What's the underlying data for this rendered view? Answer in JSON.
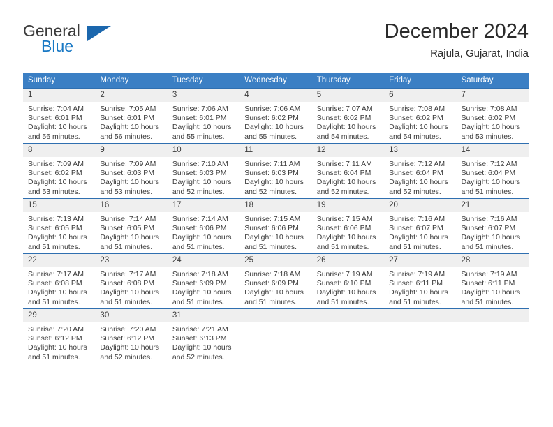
{
  "brand": {
    "name_top": "General",
    "name_bottom": "Blue",
    "triangle_icon": "triangle-logo-icon",
    "color_blue": "#1878c4",
    "color_triangle": "#1b67ad"
  },
  "header": {
    "title": "December 2024",
    "subtitle": "Rajula, Gujarat, India"
  },
  "theme": {
    "header_row_bg": "#3b7fc4",
    "row_border": "#2f6fb0",
    "daynum_bg": "#efefef",
    "text": "#3c3c3c"
  },
  "weekday_headers": [
    "Sunday",
    "Monday",
    "Tuesday",
    "Wednesday",
    "Thursday",
    "Friday",
    "Saturday"
  ],
  "labels": {
    "sunrise_prefix": "Sunrise:",
    "sunset_prefix": "Sunset:",
    "daylight_prefix": "Daylight:"
  },
  "weeks": [
    [
      {
        "day": "1",
        "sunrise": "Sunrise: 7:04 AM",
        "sunset": "Sunset: 6:01 PM",
        "daylight_1": "Daylight: 10 hours",
        "daylight_2": "and 56 minutes."
      },
      {
        "day": "2",
        "sunrise": "Sunrise: 7:05 AM",
        "sunset": "Sunset: 6:01 PM",
        "daylight_1": "Daylight: 10 hours",
        "daylight_2": "and 56 minutes."
      },
      {
        "day": "3",
        "sunrise": "Sunrise: 7:06 AM",
        "sunset": "Sunset: 6:01 PM",
        "daylight_1": "Daylight: 10 hours",
        "daylight_2": "and 55 minutes."
      },
      {
        "day": "4",
        "sunrise": "Sunrise: 7:06 AM",
        "sunset": "Sunset: 6:02 PM",
        "daylight_1": "Daylight: 10 hours",
        "daylight_2": "and 55 minutes."
      },
      {
        "day": "5",
        "sunrise": "Sunrise: 7:07 AM",
        "sunset": "Sunset: 6:02 PM",
        "daylight_1": "Daylight: 10 hours",
        "daylight_2": "and 54 minutes."
      },
      {
        "day": "6",
        "sunrise": "Sunrise: 7:08 AM",
        "sunset": "Sunset: 6:02 PM",
        "daylight_1": "Daylight: 10 hours",
        "daylight_2": "and 54 minutes."
      },
      {
        "day": "7",
        "sunrise": "Sunrise: 7:08 AM",
        "sunset": "Sunset: 6:02 PM",
        "daylight_1": "Daylight: 10 hours",
        "daylight_2": "and 53 minutes."
      }
    ],
    [
      {
        "day": "8",
        "sunrise": "Sunrise: 7:09 AM",
        "sunset": "Sunset: 6:02 PM",
        "daylight_1": "Daylight: 10 hours",
        "daylight_2": "and 53 minutes."
      },
      {
        "day": "9",
        "sunrise": "Sunrise: 7:09 AM",
        "sunset": "Sunset: 6:03 PM",
        "daylight_1": "Daylight: 10 hours",
        "daylight_2": "and 53 minutes."
      },
      {
        "day": "10",
        "sunrise": "Sunrise: 7:10 AM",
        "sunset": "Sunset: 6:03 PM",
        "daylight_1": "Daylight: 10 hours",
        "daylight_2": "and 52 minutes."
      },
      {
        "day": "11",
        "sunrise": "Sunrise: 7:11 AM",
        "sunset": "Sunset: 6:03 PM",
        "daylight_1": "Daylight: 10 hours",
        "daylight_2": "and 52 minutes."
      },
      {
        "day": "12",
        "sunrise": "Sunrise: 7:11 AM",
        "sunset": "Sunset: 6:04 PM",
        "daylight_1": "Daylight: 10 hours",
        "daylight_2": "and 52 minutes."
      },
      {
        "day": "13",
        "sunrise": "Sunrise: 7:12 AM",
        "sunset": "Sunset: 6:04 PM",
        "daylight_1": "Daylight: 10 hours",
        "daylight_2": "and 52 minutes."
      },
      {
        "day": "14",
        "sunrise": "Sunrise: 7:12 AM",
        "sunset": "Sunset: 6:04 PM",
        "daylight_1": "Daylight: 10 hours",
        "daylight_2": "and 51 minutes."
      }
    ],
    [
      {
        "day": "15",
        "sunrise": "Sunrise: 7:13 AM",
        "sunset": "Sunset: 6:05 PM",
        "daylight_1": "Daylight: 10 hours",
        "daylight_2": "and 51 minutes."
      },
      {
        "day": "16",
        "sunrise": "Sunrise: 7:14 AM",
        "sunset": "Sunset: 6:05 PM",
        "daylight_1": "Daylight: 10 hours",
        "daylight_2": "and 51 minutes."
      },
      {
        "day": "17",
        "sunrise": "Sunrise: 7:14 AM",
        "sunset": "Sunset: 6:06 PM",
        "daylight_1": "Daylight: 10 hours",
        "daylight_2": "and 51 minutes."
      },
      {
        "day": "18",
        "sunrise": "Sunrise: 7:15 AM",
        "sunset": "Sunset: 6:06 PM",
        "daylight_1": "Daylight: 10 hours",
        "daylight_2": "and 51 minutes."
      },
      {
        "day": "19",
        "sunrise": "Sunrise: 7:15 AM",
        "sunset": "Sunset: 6:06 PM",
        "daylight_1": "Daylight: 10 hours",
        "daylight_2": "and 51 minutes."
      },
      {
        "day": "20",
        "sunrise": "Sunrise: 7:16 AM",
        "sunset": "Sunset: 6:07 PM",
        "daylight_1": "Daylight: 10 hours",
        "daylight_2": "and 51 minutes."
      },
      {
        "day": "21",
        "sunrise": "Sunrise: 7:16 AM",
        "sunset": "Sunset: 6:07 PM",
        "daylight_1": "Daylight: 10 hours",
        "daylight_2": "and 51 minutes."
      }
    ],
    [
      {
        "day": "22",
        "sunrise": "Sunrise: 7:17 AM",
        "sunset": "Sunset: 6:08 PM",
        "daylight_1": "Daylight: 10 hours",
        "daylight_2": "and 51 minutes."
      },
      {
        "day": "23",
        "sunrise": "Sunrise: 7:17 AM",
        "sunset": "Sunset: 6:08 PM",
        "daylight_1": "Daylight: 10 hours",
        "daylight_2": "and 51 minutes."
      },
      {
        "day": "24",
        "sunrise": "Sunrise: 7:18 AM",
        "sunset": "Sunset: 6:09 PM",
        "daylight_1": "Daylight: 10 hours",
        "daylight_2": "and 51 minutes."
      },
      {
        "day": "25",
        "sunrise": "Sunrise: 7:18 AM",
        "sunset": "Sunset: 6:09 PM",
        "daylight_1": "Daylight: 10 hours",
        "daylight_2": "and 51 minutes."
      },
      {
        "day": "26",
        "sunrise": "Sunrise: 7:19 AM",
        "sunset": "Sunset: 6:10 PM",
        "daylight_1": "Daylight: 10 hours",
        "daylight_2": "and 51 minutes."
      },
      {
        "day": "27",
        "sunrise": "Sunrise: 7:19 AM",
        "sunset": "Sunset: 6:11 PM",
        "daylight_1": "Daylight: 10 hours",
        "daylight_2": "and 51 minutes."
      },
      {
        "day": "28",
        "sunrise": "Sunrise: 7:19 AM",
        "sunset": "Sunset: 6:11 PM",
        "daylight_1": "Daylight: 10 hours",
        "daylight_2": "and 51 minutes."
      }
    ],
    [
      {
        "day": "29",
        "sunrise": "Sunrise: 7:20 AM",
        "sunset": "Sunset: 6:12 PM",
        "daylight_1": "Daylight: 10 hours",
        "daylight_2": "and 51 minutes."
      },
      {
        "day": "30",
        "sunrise": "Sunrise: 7:20 AM",
        "sunset": "Sunset: 6:12 PM",
        "daylight_1": "Daylight: 10 hours",
        "daylight_2": "and 52 minutes."
      },
      {
        "day": "31",
        "sunrise": "Sunrise: 7:21 AM",
        "sunset": "Sunset: 6:13 PM",
        "daylight_1": "Daylight: 10 hours",
        "daylight_2": "and 52 minutes."
      },
      {
        "day": "",
        "sunrise": "",
        "sunset": "",
        "daylight_1": "",
        "daylight_2": ""
      },
      {
        "day": "",
        "sunrise": "",
        "sunset": "",
        "daylight_1": "",
        "daylight_2": ""
      },
      {
        "day": "",
        "sunrise": "",
        "sunset": "",
        "daylight_1": "",
        "daylight_2": ""
      },
      {
        "day": "",
        "sunrise": "",
        "sunset": "",
        "daylight_1": "",
        "daylight_2": ""
      }
    ]
  ]
}
